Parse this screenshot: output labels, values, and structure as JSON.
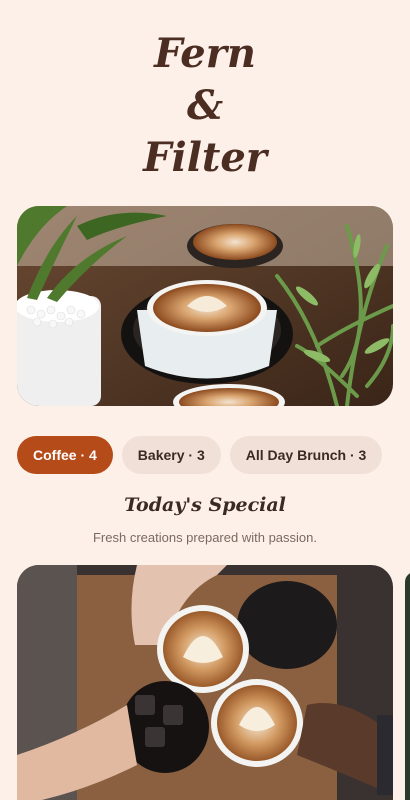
{
  "brand": {
    "line1": "Fern",
    "line2": "&",
    "line3": "Filter"
  },
  "hero_image": {
    "icon": "coffee-cups-plants-photo"
  },
  "categories": [
    {
      "label": "Coffee · 4",
      "active": true
    },
    {
      "label": "Bakery · 3",
      "active": false
    },
    {
      "label": "All Day Brunch · 3",
      "active": false
    }
  ],
  "special": {
    "title": "Today's Special",
    "subtitle": "Fresh creations prepared with passion."
  },
  "special_card": {
    "icon": "cheers-coffee-photo"
  },
  "colors": {
    "background": "#fdf0e8",
    "accent": "#b54b18",
    "chip_inactive": "#f0e0d8",
    "title": "#4b2d22"
  }
}
